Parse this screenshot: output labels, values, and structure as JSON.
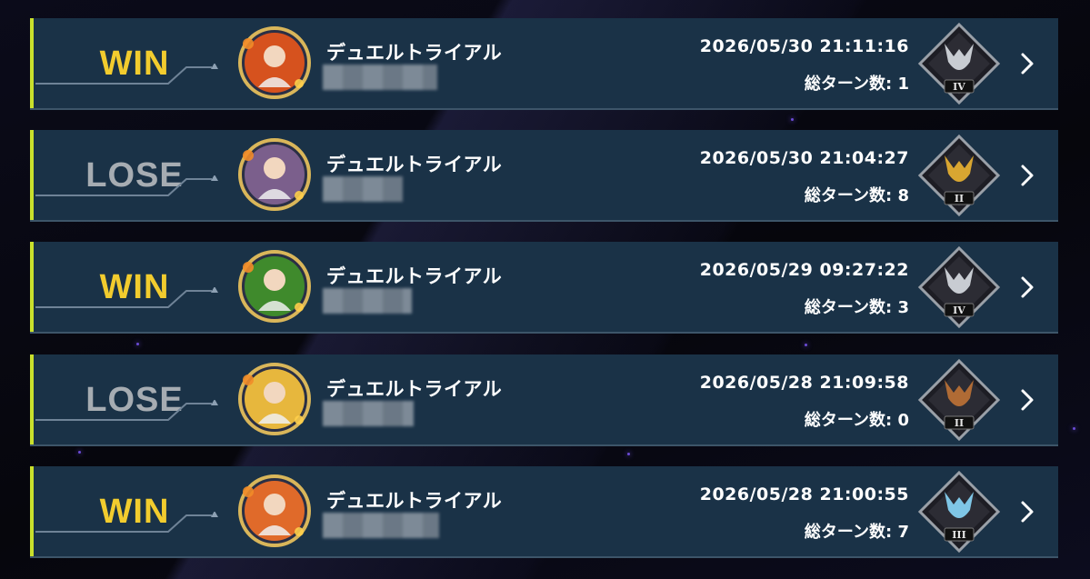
{
  "records": [
    {
      "result": "WIN",
      "result_type": "win",
      "mode": "デュエルトライアル",
      "datetime": "2026/05/30 21:11:16",
      "turns": "総ターン数: 1",
      "rank_icon": "stag-rank-icon",
      "rank_numeral": "IV",
      "rank_color": "#c8ccd2",
      "portrait_theme": "#d6521e"
    },
    {
      "result": "LOSE",
      "result_type": "lose",
      "mode": "デュエルトライアル",
      "datetime": "2026/05/30 21:04:27",
      "turns": "総ターン数: 8",
      "rank_icon": "eagle-rank-icon",
      "rank_numeral": "II",
      "rank_color": "#d9a631",
      "portrait_theme": "#7b5f8c"
    },
    {
      "result": "WIN",
      "result_type": "win",
      "mode": "デュエルトライアル",
      "datetime": "2026/05/29 09:27:22",
      "turns": "総ターン数: 3",
      "rank_icon": "stag-rank-icon",
      "rank_numeral": "IV",
      "rank_color": "#c8ccd2",
      "portrait_theme": "#3f8a2c"
    },
    {
      "result": "LOSE",
      "result_type": "lose",
      "mode": "デュエルトライアル",
      "datetime": "2026/05/28 21:09:58",
      "turns": "総ターン数: 0",
      "rank_icon": "bee-rank-icon",
      "rank_numeral": "II",
      "rank_color": "#b06b35",
      "portrait_theme": "#e7b73d"
    },
    {
      "result": "WIN",
      "result_type": "win",
      "mode": "デュエルトライアル",
      "datetime": "2026/05/28 21:00:55",
      "turns": "総ターン数: 7",
      "rank_icon": "wolf-rank-icon",
      "rank_numeral": "III",
      "rank_color": "#7fc6e6",
      "portrait_theme": "#e06a2a"
    }
  ]
}
